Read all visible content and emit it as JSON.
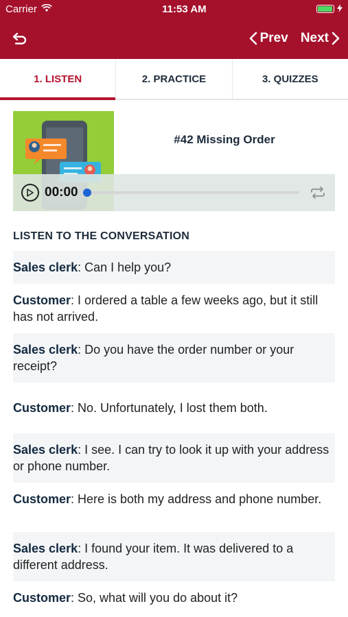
{
  "status": {
    "carrier": "Carrier",
    "time": "11:53 AM",
    "battery_level": 0.95
  },
  "nav": {
    "prev": "Prev",
    "next": "Next"
  },
  "tabs": [
    "1. LISTEN",
    "2. PRACTICE",
    "3. QUIZZES"
  ],
  "lesson": {
    "title": "#42 Missing Order",
    "time": "00:00",
    "progress": 0
  },
  "section_title": "LISTEN TO THE CONVERSATION",
  "conversation": [
    {
      "speaker": "Sales clerk",
      "text": ": Can I help you?"
    },
    {
      "speaker": "Customer",
      "text": ": I ordered a table a few weeks ago, but it still has not arrived."
    },
    {
      "speaker": "Sales clerk",
      "text": ": Do you have the order number or your receipt?"
    },
    {
      "speaker": "Customer",
      "text": ": No.  Unfortunately, I lost them both."
    },
    {
      "speaker": "Sales clerk",
      "text": ": I see.  I can try to look it up with your address or phone number."
    },
    {
      "speaker": "Customer",
      "text": ": Here is both my address and phone number."
    },
    {
      "speaker": "Sales clerk",
      "text": ": I found your item.  It was delivered to a different address."
    },
    {
      "speaker": "Customer",
      "text": ": So, what will you do about it?"
    }
  ],
  "colors": {
    "brand": "#a5102b",
    "accent": "#b5122d",
    "heading": "#1d2b3a"
  }
}
